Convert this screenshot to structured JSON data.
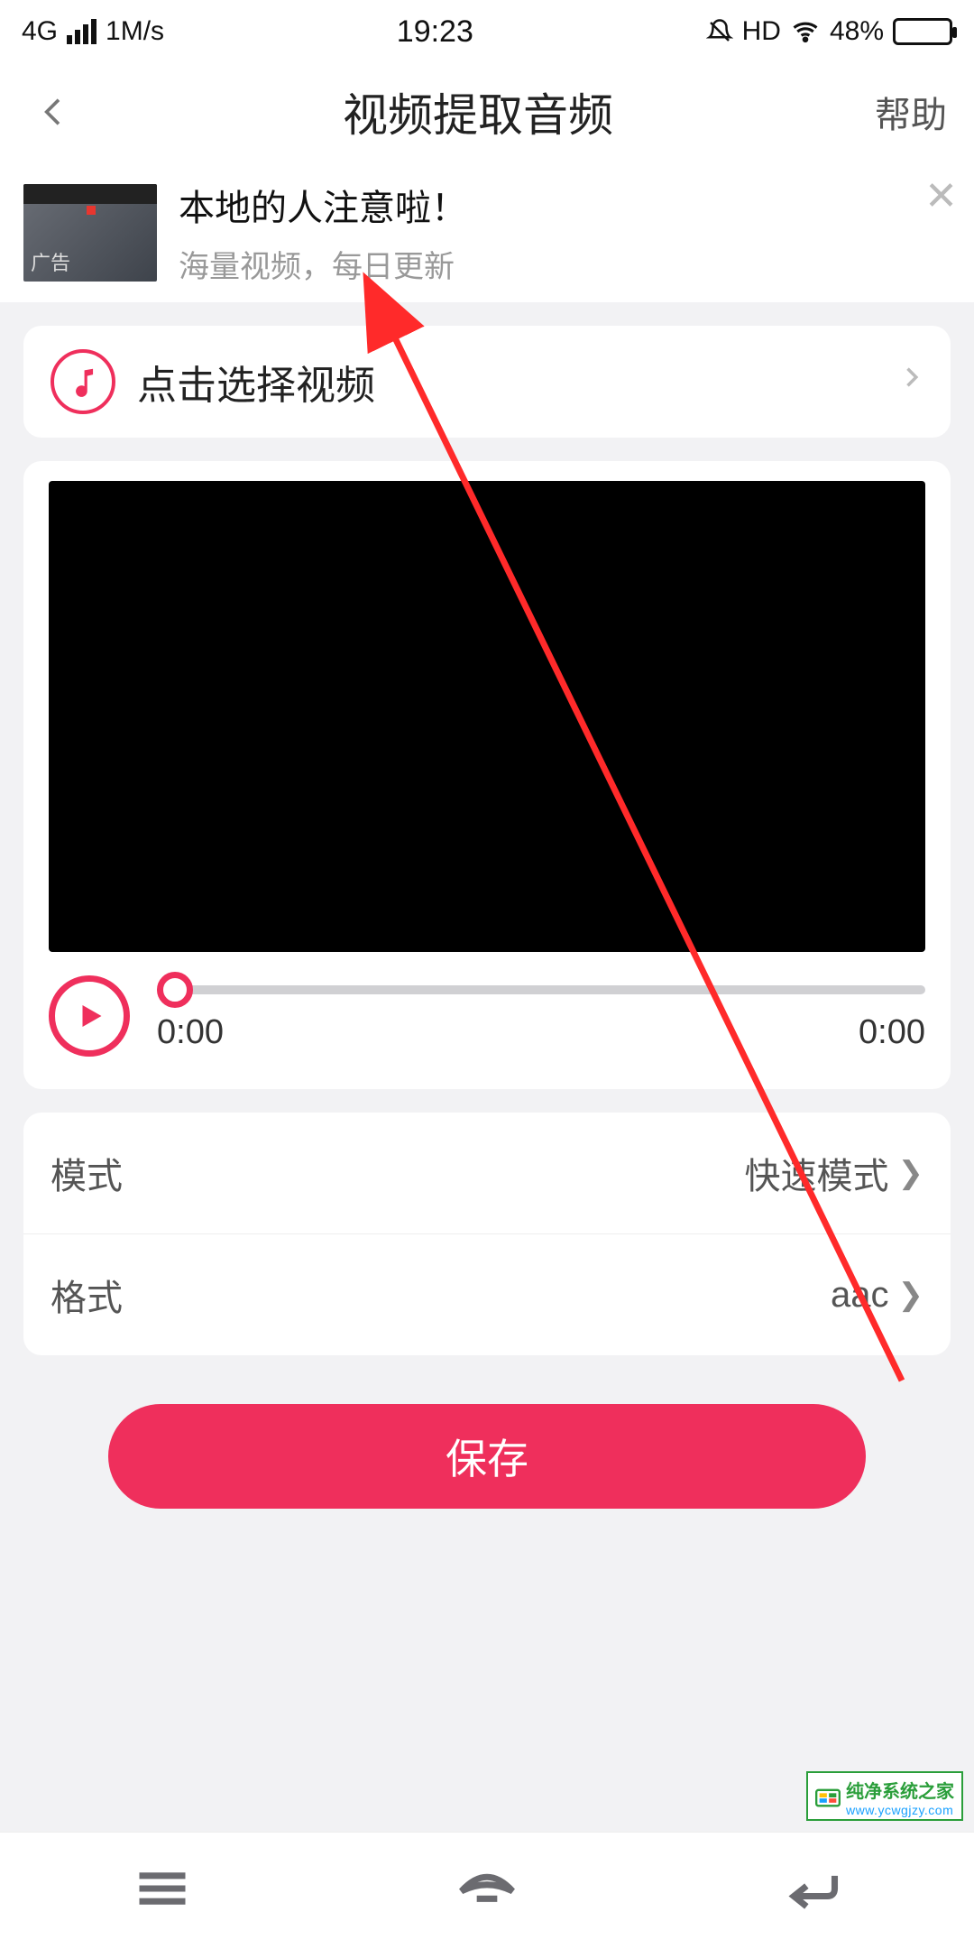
{
  "status": {
    "net_type": "4G",
    "speed": "1M/s",
    "time": "19:23",
    "hd": "HD",
    "battery_pct": "48%"
  },
  "header": {
    "title": "视频提取音频",
    "help": "帮助"
  },
  "ad": {
    "title": "本地的人注意啦！",
    "sub": "海量视频，每日更新",
    "tag": "广告"
  },
  "select": {
    "label": "点击选择视频"
  },
  "player": {
    "current": "0:00",
    "total": "0:00"
  },
  "settings": {
    "mode_label": "模式",
    "mode_value": "快速模式",
    "format_label": "格式",
    "format_value": "aac"
  },
  "save_label": "保存",
  "watermark": {
    "text": "纯净系统之家",
    "url": "www.ycwgjzy.com"
  }
}
